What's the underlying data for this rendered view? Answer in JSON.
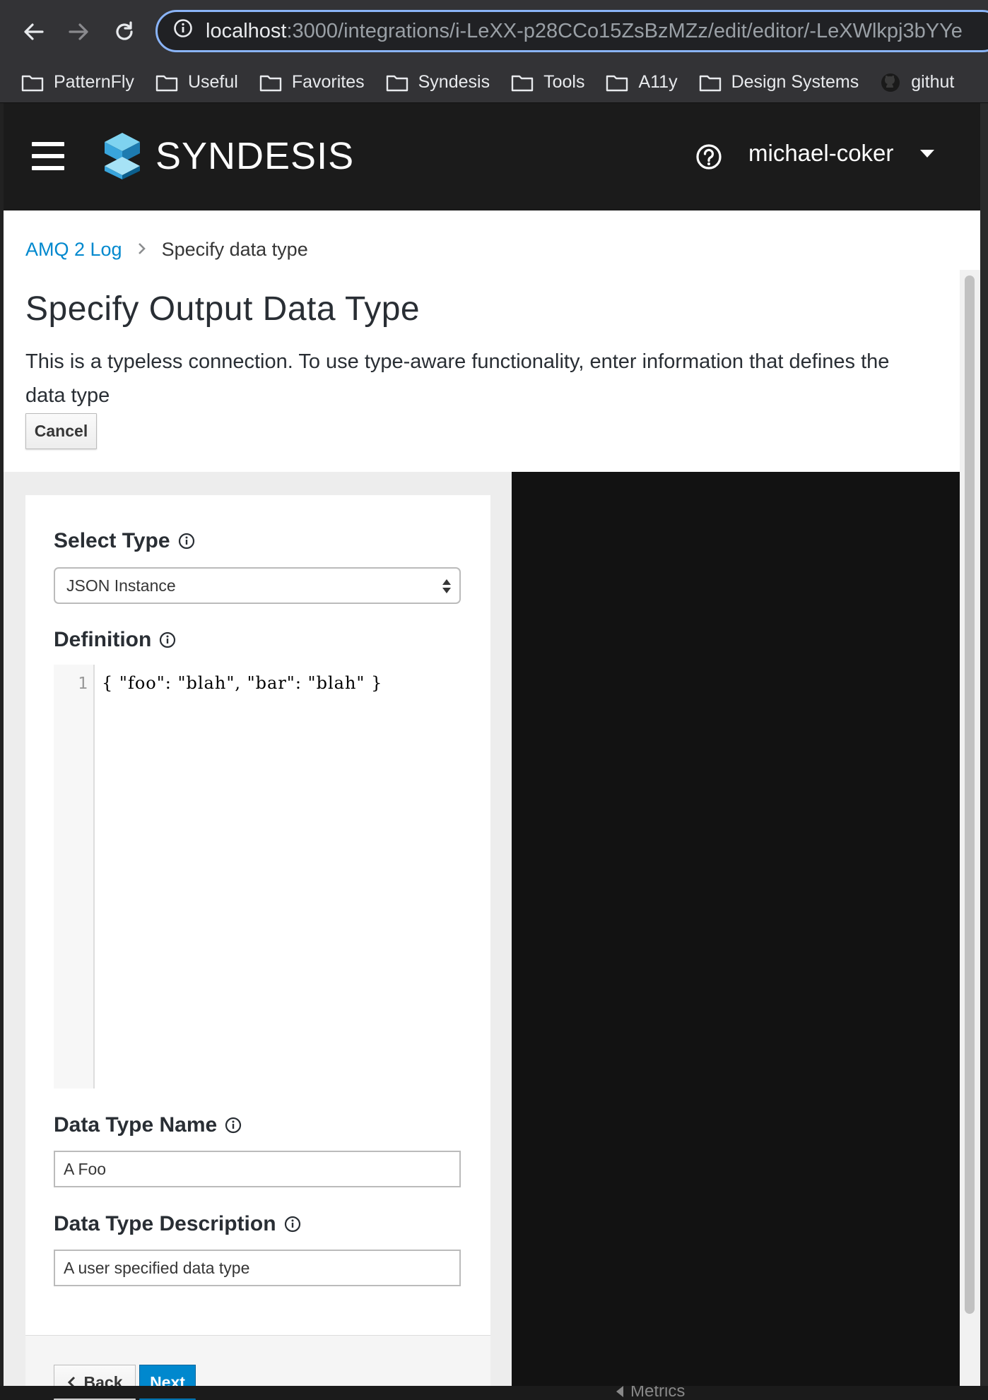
{
  "browser": {
    "url_host": "localhost",
    "url_path": ":3000/integrations/i-LeXX-p28CCo15ZsBzMZz/edit/editor/-LeXWlkpj3bYYe",
    "bookmarks": [
      "PatternFly",
      "Useful",
      "Favorites",
      "Syndesis",
      "Tools",
      "A11y",
      "Design Systems",
      "githut"
    ]
  },
  "header": {
    "brand": "SYNDESIS",
    "username": "michael-coker"
  },
  "breadcrumb": {
    "link": "AMQ 2 Log",
    "current": "Specify data type"
  },
  "page": {
    "title": "Specify Output Data Type",
    "description": "This is a typeless connection. To use type-aware functionality, enter information that defines the data type",
    "cancel_label": "Cancel"
  },
  "form": {
    "select_type_label": "Select Type",
    "select_type_value": "JSON Instance",
    "definition_label": "Definition",
    "definition_line_number": "1",
    "definition_code": "{ \"foo\": \"blah\", \"bar\": \"blah\" }",
    "data_type_name_label": "Data Type Name",
    "data_type_name_value": "A Foo",
    "data_type_description_label": "Data Type Description",
    "data_type_description_value": "A user specified data type",
    "back_label": "Back",
    "next_label": "Next"
  },
  "footer_peek": {
    "metrics_label": "Metrics"
  },
  "colors": {
    "accent": "#0088ce",
    "masthead": "#1b1b1b",
    "dark_panel": "#121212"
  }
}
